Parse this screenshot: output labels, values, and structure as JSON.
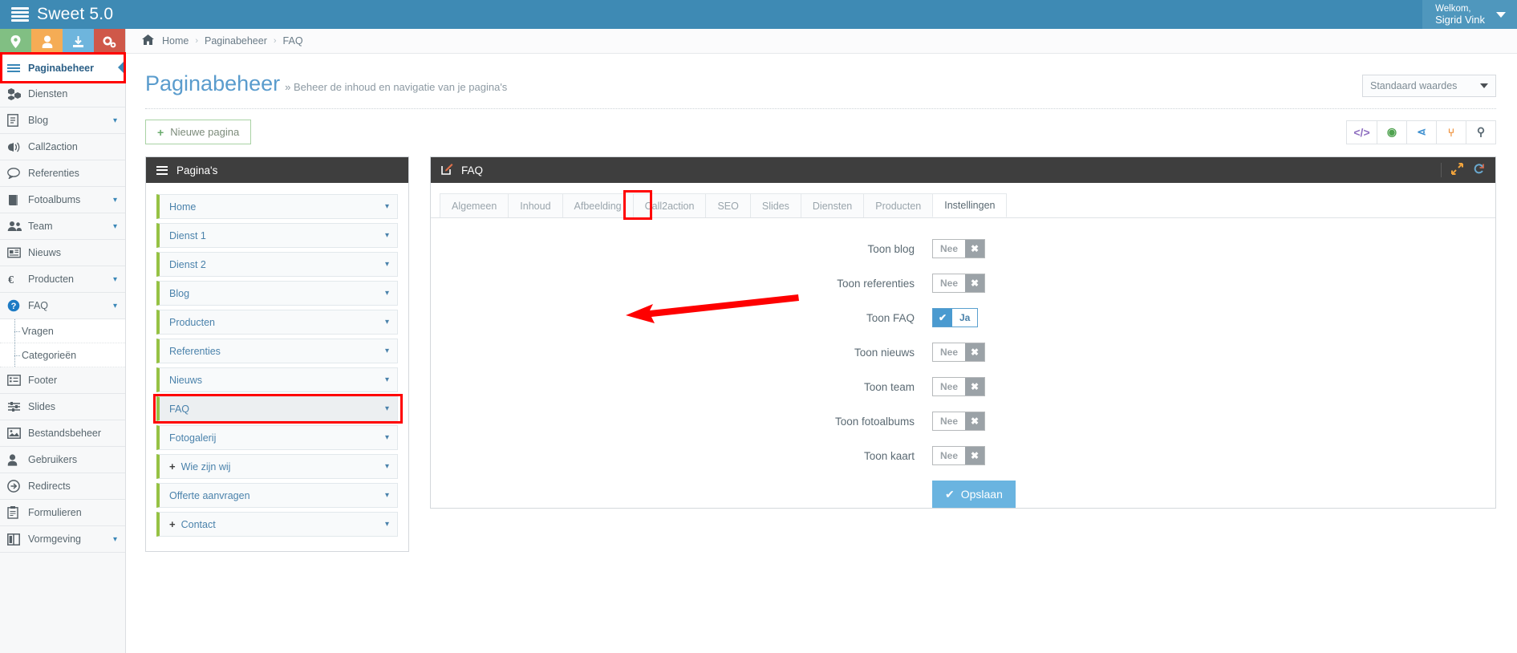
{
  "app": {
    "title": "Sweet 5.0",
    "brand_icon": "server-stack-icon"
  },
  "topbar": {
    "welcome_label": "Welkom,",
    "user_name": "Sigrid Vink",
    "caret_icon": "caret-down-icon"
  },
  "quickbar": [
    {
      "name": "location-pin-icon",
      "color": "#81bf83"
    },
    {
      "name": "user-icon",
      "color": "#f5ac55"
    },
    {
      "name": "download-icon",
      "color": "#6eb5dd"
    },
    {
      "name": "gears-icon",
      "color": "#cf5849"
    }
  ],
  "sidebar": {
    "active": {
      "label": "Paginabeheer",
      "icon": "hamburger-icon"
    },
    "items": [
      {
        "label": "Diensten",
        "icon": "cubes-icon",
        "chevron": false
      },
      {
        "label": "Blog",
        "icon": "file-text-icon",
        "chevron": true
      },
      {
        "label": "Call2action",
        "icon": "bullhorn-icon",
        "chevron": false
      },
      {
        "label": "Referenties",
        "icon": "comment-icon",
        "chevron": false
      },
      {
        "label": "Fotoalbums",
        "icon": "book-icon",
        "chevron": true
      },
      {
        "label": "Team",
        "icon": "users-icon",
        "chevron": true
      },
      {
        "label": "Nieuws",
        "icon": "newspaper-icon",
        "chevron": false
      },
      {
        "label": "Producten",
        "icon": "euro-icon",
        "chevron": true
      },
      {
        "label": "FAQ",
        "icon": "question-circle-icon",
        "chevron": true
      }
    ],
    "sub_items": [
      {
        "label": "Vragen"
      },
      {
        "label": "Categorieën"
      }
    ],
    "items_after": [
      {
        "label": "Footer",
        "icon": "list-alt-icon",
        "chevron": false
      },
      {
        "label": "Slides",
        "icon": "sliders-icon",
        "chevron": false
      },
      {
        "label": "Bestandsbeheer",
        "icon": "image-icon",
        "chevron": false
      },
      {
        "label": "Gebruikers",
        "icon": "user-icon",
        "chevron": false
      },
      {
        "label": "Redirects",
        "icon": "arrow-circle-right-icon",
        "chevron": false
      },
      {
        "label": "Formulieren",
        "icon": "clipboard-icon",
        "chevron": false
      },
      {
        "label": "Vormgeving",
        "icon": "columns-icon",
        "chevron": true
      }
    ]
  },
  "breadcrumb": {
    "home_icon": "home-icon",
    "items": [
      "Home",
      "Paginabeheer",
      "FAQ"
    ],
    "separator": "›"
  },
  "page": {
    "title": "Paginabeheer",
    "subtitle": "» Beheer de inhoud en navigatie van je pagina's",
    "standard_select": {
      "value": "Standaard waardes",
      "caret": "caret-down-icon"
    }
  },
  "toolbar": {
    "new_page_label": "Nieuwe pagina",
    "new_page_icon": "plus-icon",
    "icons": [
      {
        "name": "code-icon",
        "glyph": "</>",
        "color": "#8e6ec0"
      },
      {
        "name": "eye-icon",
        "glyph": "◉",
        "color": "#4fa24f"
      },
      {
        "name": "share-icon",
        "glyph": "⋖",
        "color": "#3d8fd0"
      },
      {
        "name": "sitemap-icon",
        "glyph": "⑂",
        "color": "#ee8d34"
      },
      {
        "name": "search-icon",
        "glyph": "⚲",
        "color": "#5c6b75"
      }
    ]
  },
  "pages_panel": {
    "header": "Pagina's",
    "header_icon": "hamburger-icon",
    "rows": [
      {
        "label": "Home",
        "plus": false,
        "selected": false
      },
      {
        "label": "Dienst 1",
        "plus": false,
        "selected": false
      },
      {
        "label": "Dienst 2",
        "plus": false,
        "selected": false
      },
      {
        "label": "Blog",
        "plus": false,
        "selected": false
      },
      {
        "label": "Producten",
        "plus": false,
        "selected": false
      },
      {
        "label": "Referenties",
        "plus": false,
        "selected": false
      },
      {
        "label": "Nieuws",
        "plus": false,
        "selected": false
      },
      {
        "label": "FAQ",
        "plus": false,
        "selected": true
      },
      {
        "label": "Fotogalerij",
        "plus": false,
        "selected": false
      },
      {
        "label": "Wie zijn wij",
        "plus": true,
        "selected": false
      },
      {
        "label": "Offerte aanvragen",
        "plus": false,
        "selected": false
      },
      {
        "label": "Contact",
        "plus": true,
        "selected": false
      }
    ]
  },
  "detail_panel": {
    "header": "FAQ",
    "header_icon": "edit-pencil-icon",
    "header_actions": [
      {
        "name": "expand-icon",
        "glyph": "⤢",
        "color": "#f0a33c"
      },
      {
        "name": "refresh-icon",
        "glyph": "⟳",
        "color": "#6aa9cf"
      }
    ],
    "tabs": [
      {
        "label": "Algemeen",
        "active": false
      },
      {
        "label": "Inhoud",
        "active": false
      },
      {
        "label": "Afbeelding",
        "active": false
      },
      {
        "label": "Call2action",
        "active": false
      },
      {
        "label": "SEO",
        "active": false
      },
      {
        "label": "Slides",
        "active": false
      },
      {
        "label": "Diensten",
        "active": false
      },
      {
        "label": "Producten",
        "active": false
      },
      {
        "label": "Instellingen",
        "active": true
      }
    ],
    "fields": [
      {
        "label": "Toon blog",
        "value": "Nee",
        "on": false
      },
      {
        "label": "Toon referenties",
        "value": "Nee",
        "on": false
      },
      {
        "label": "Toon FAQ",
        "value": "Ja",
        "on": true
      },
      {
        "label": "Toon nieuws",
        "value": "Nee",
        "on": false
      },
      {
        "label": "Toon team",
        "value": "Nee",
        "on": false
      },
      {
        "label": "Toon fotoalbums",
        "value": "Nee",
        "on": false
      },
      {
        "label": "Toon kaart",
        "value": "Nee",
        "on": false
      }
    ],
    "save_label": "Opslaan",
    "save_icon": "check-icon"
  },
  "annotations": {
    "highlight_color": "#fe0000",
    "boxes": [
      {
        "name": "sidebar-paginabeheer-highlight"
      },
      {
        "name": "pages-faq-row-highlight"
      },
      {
        "name": "tab-instellingen-highlight"
      }
    ],
    "arrow": {
      "name": "arrow-to-toon-faq-switch",
      "color": "#fe0000"
    }
  }
}
